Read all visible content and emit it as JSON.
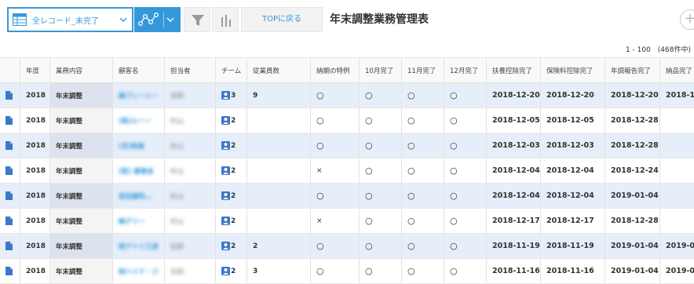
{
  "toolbar": {
    "view_name": "全レコード_未完了",
    "top_button": "TOPに戻る",
    "app_title": "年末調整業務管理表",
    "add_button": "+",
    "pager": "1 - 100　(468件中)"
  },
  "colors": {
    "accent": "#3498db",
    "row_highlight": "#e6eef9"
  },
  "table": {
    "headers": [
      "年度",
      "業務内容",
      "顧客名",
      "担当者",
      "チーム",
      "従業員数",
      "納期の特例",
      "10月完了",
      "11月完了",
      "12月完了",
      "扶養控除完了",
      "保険料控除完了",
      "年調報告完了",
      "納品完了"
    ],
    "rows": [
      {
        "year": "2018",
        "work": "年末調整",
        "client": "㈱ブレーシー",
        "staff": "吉岡",
        "team": "3",
        "employees": "9",
        "special": "○",
        "oct": "○",
        "nov": "○",
        "dec": "○",
        "fuyo": "2018-12-20",
        "hoken": "2018-12-20",
        "report": "2018-12-20",
        "deliver": "2018-1"
      },
      {
        "year": "2018",
        "work": "年末調整",
        "client": "(株)ルーー",
        "staff": "杉山",
        "team": "2",
        "employees": "",
        "special": "○",
        "oct": "○",
        "nov": "○",
        "dec": "○",
        "fuyo": "2018-12-05",
        "hoken": "2018-12-05",
        "report": "2018-12-28",
        "deliver": ""
      },
      {
        "year": "2018",
        "work": "年末調整",
        "client": "(合)和泉",
        "staff": "杉山",
        "team": "2",
        "employees": "",
        "special": "○",
        "oct": "○",
        "nov": "○",
        "dec": "○",
        "fuyo": "2018-12-03",
        "hoken": "2018-12-03",
        "report": "2018-12-28",
        "deliver": ""
      },
      {
        "year": "2018",
        "work": "年末調整",
        "client": "(医) 康善会",
        "staff": "杉山",
        "team": "2",
        "employees": "",
        "special": "×",
        "oct": "○",
        "nov": "○",
        "dec": "○",
        "fuyo": "2018-12-04",
        "hoken": "2018-12-04",
        "report": "2018-12-24",
        "deliver": ""
      },
      {
        "year": "2018",
        "work": "年末調整",
        "client": "宮田歯科…",
        "staff": "杉山",
        "team": "2",
        "employees": "",
        "special": "○",
        "oct": "○",
        "nov": "○",
        "dec": "○",
        "fuyo": "2018-12-04",
        "hoken": "2018-12-04",
        "report": "2019-01-04",
        "deliver": ""
      },
      {
        "year": "2018",
        "work": "年末調整",
        "client": "㈱グリー",
        "staff": "杉山",
        "team": "2",
        "employees": "",
        "special": "×",
        "oct": "○",
        "nov": "○",
        "dec": "○",
        "fuyo": "2018-12-17",
        "hoken": "2018-12-17",
        "report": "2018-12-28",
        "deliver": ""
      },
      {
        "year": "2018",
        "work": "年末調整",
        "client": "㈲アトリ工房",
        "staff": "石田",
        "team": "2",
        "employees": "2",
        "special": "○",
        "oct": "○",
        "nov": "○",
        "dec": "○",
        "fuyo": "2018-11-19",
        "hoken": "2018-11-19",
        "report": "2019-01-04",
        "deliver": "2019-0"
      },
      {
        "year": "2018",
        "work": "年末調整",
        "client": "㈲ハイド・ジ",
        "staff": "石田",
        "team": "2",
        "employees": "3",
        "special": "○",
        "oct": "○",
        "nov": "○",
        "dec": "○",
        "fuyo": "2018-11-16",
        "hoken": "2018-11-16",
        "report": "2019-01-04",
        "deliver": "2019-0"
      }
    ]
  }
}
